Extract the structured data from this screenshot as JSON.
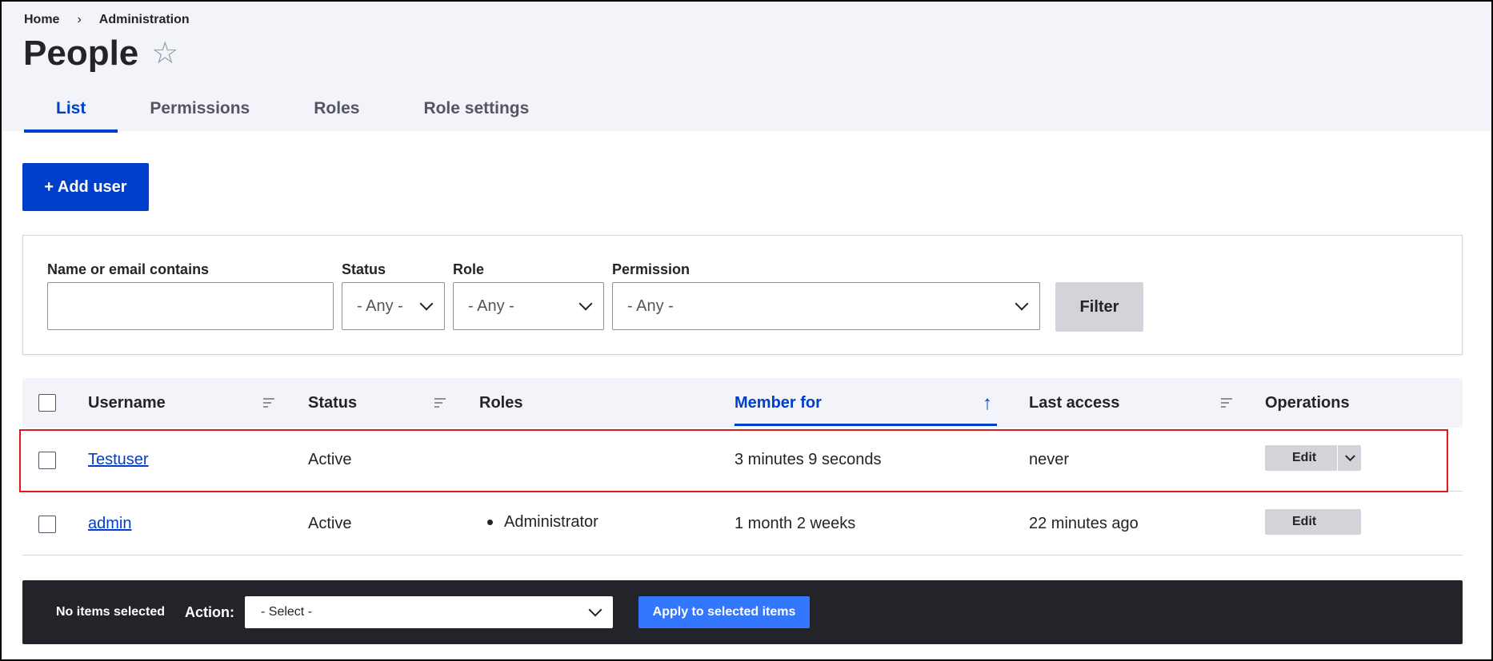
{
  "breadcrumb": {
    "home": "Home",
    "separator": "›",
    "admin": "Administration"
  },
  "page": {
    "title": "People",
    "star_icon": "☆"
  },
  "tabs": [
    {
      "label": "List",
      "active": true
    },
    {
      "label": "Permissions",
      "active": false
    },
    {
      "label": "Roles",
      "active": false
    },
    {
      "label": "Role settings",
      "active": false
    }
  ],
  "add_user_label": "+ Add user",
  "filters": {
    "name_label": "Name or email contains",
    "name_value": "",
    "status_label": "Status",
    "status_value": "- Any -",
    "role_label": "Role",
    "role_value": "- Any -",
    "permission_label": "Permission",
    "permission_value": "- Any -",
    "filter_button": "Filter"
  },
  "table": {
    "headers": {
      "username": "Username",
      "status": "Status",
      "roles": "Roles",
      "member_for": "Member for",
      "last_access": "Last access",
      "operations": "Operations"
    },
    "sorted_column": "member_for",
    "sort_direction": "ascending",
    "rows": [
      {
        "username": "Testuser",
        "status": "Active",
        "roles": "",
        "member_for": "3 minutes 9 seconds",
        "last_access": "never",
        "operation": "Edit",
        "has_dropdown": true,
        "highlighted": true
      },
      {
        "username": "admin",
        "status": "Active",
        "roles": "Administrator",
        "member_for": "1 month 2 weeks",
        "last_access": "22 minutes ago",
        "operation": "Edit",
        "has_dropdown": false,
        "highlighted": false
      }
    ]
  },
  "bulk": {
    "selection_text": "No items selected",
    "action_label": "Action:",
    "select_value": "- Select -",
    "apply_button": "Apply to selected items"
  },
  "colors": {
    "accent": "#003ecc",
    "apply": "#3377ff",
    "highlight": "#e0181e",
    "header_bg": "#f3f4f9",
    "bulk_bg": "#232429"
  }
}
